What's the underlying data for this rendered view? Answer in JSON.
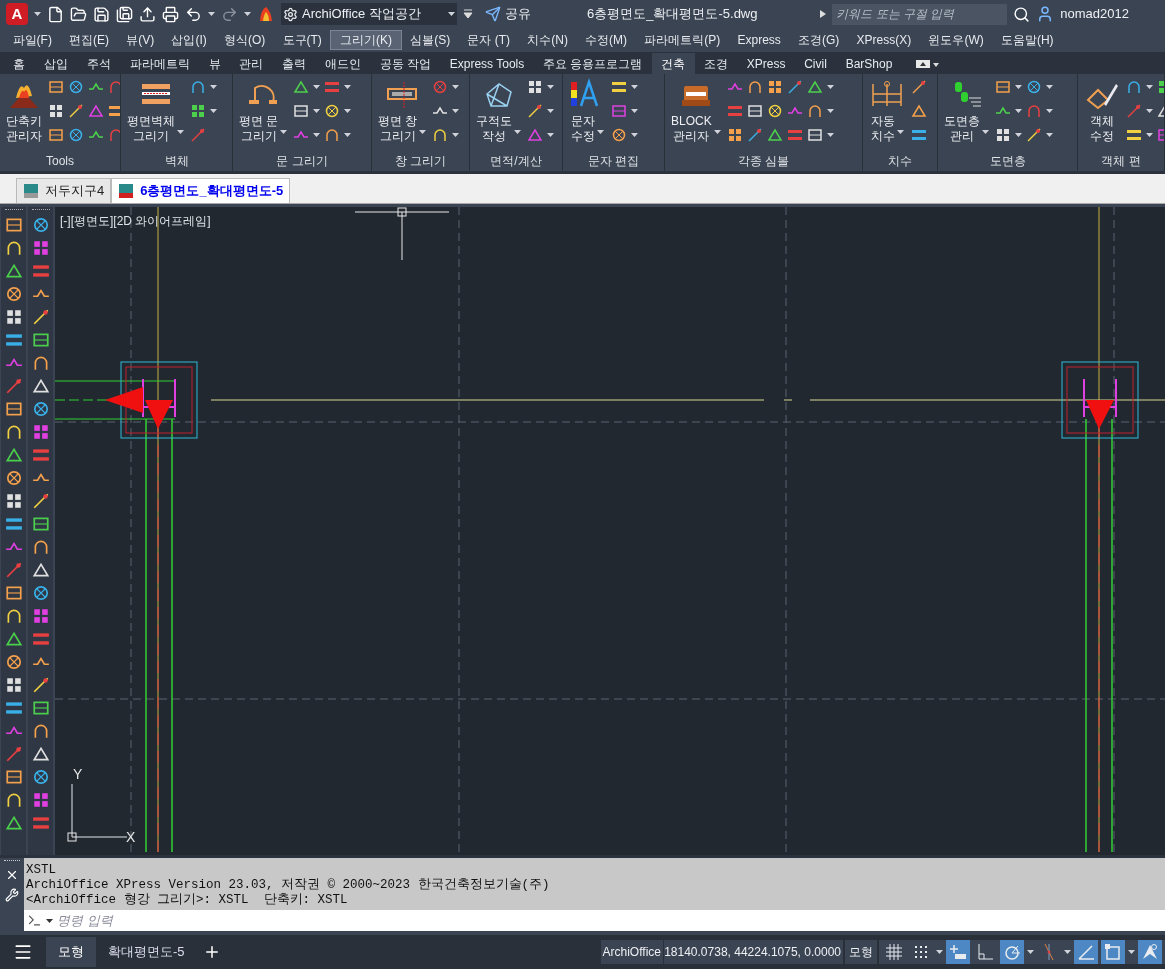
{
  "title_bar": {
    "logo_letter": "A",
    "workspace": "ArchiOffice 작업공간",
    "share": "공유",
    "file_title": "6층평면도_확대평면도-5.dwg",
    "search": {
      "placeholder": "키워드 또는 구절 입력"
    },
    "user": "nomad2012"
  },
  "menu_bar": [
    {
      "label": "파일(F)",
      "highlighted": false
    },
    {
      "label": "편집(E)",
      "highlighted": false
    },
    {
      "label": "뷰(V)",
      "highlighted": false
    },
    {
      "label": "삽입(I)",
      "highlighted": false
    },
    {
      "label": "형식(O)",
      "highlighted": false
    },
    {
      "label": "도구(T)",
      "highlighted": false
    },
    {
      "label": "그리기(K)",
      "highlighted": true
    },
    {
      "label": "심볼(S)",
      "highlighted": false
    },
    {
      "label": "문자 (T)",
      "highlighted": false
    },
    {
      "label": "치수(N)",
      "highlighted": false
    },
    {
      "label": "수정(M)",
      "highlighted": false
    },
    {
      "label": "파라메트릭(P)",
      "highlighted": false
    },
    {
      "label": "Express",
      "highlighted": false
    },
    {
      "label": "조경(G)",
      "highlighted": false
    },
    {
      "label": "XPress(X)",
      "highlighted": false
    },
    {
      "label": "윈도우(W)",
      "highlighted": false
    },
    {
      "label": "도움말(H)",
      "highlighted": false
    }
  ],
  "ribbon_tabs": [
    {
      "label": "홈",
      "selected": false
    },
    {
      "label": "삽입",
      "selected": false
    },
    {
      "label": "주석",
      "selected": false
    },
    {
      "label": "파라메트릭",
      "selected": false
    },
    {
      "label": "뷰",
      "selected": false
    },
    {
      "label": "관리",
      "selected": false
    },
    {
      "label": "출력",
      "selected": false
    },
    {
      "label": "애드인",
      "selected": false
    },
    {
      "label": "공동 작업",
      "selected": false
    },
    {
      "label": "Express Tools",
      "selected": false
    },
    {
      "label": "주요 응용프로그램",
      "selected": false
    },
    {
      "label": "건축",
      "selected": true
    },
    {
      "label": "조경",
      "selected": false
    },
    {
      "label": "XPress",
      "selected": false
    },
    {
      "label": "Civil",
      "selected": false
    },
    {
      "label": "BarShop",
      "selected": false
    }
  ],
  "ribbon_panels": [
    {
      "title": "Tools",
      "big_button": {
        "label": "단축키\n관리자",
        "dropdown": false
      }
    },
    {
      "title": "벽체",
      "big_button": {
        "label": "평면벽체\n그리기",
        "dropdown": true
      }
    },
    {
      "title": "문 그리기",
      "big_button": {
        "label": "평면 문\n그리기",
        "dropdown": true
      }
    },
    {
      "title": "창 그리기",
      "big_button": {
        "label": "평면 창\n그리기",
        "dropdown": true
      }
    },
    {
      "title": "면적/계산",
      "big_button": {
        "label": "구적도\n작성",
        "dropdown": true
      }
    },
    {
      "title": "문자 편집",
      "big_button": {
        "label": "문자\n수정",
        "dropdown": true
      }
    },
    {
      "title": "각종 심볼",
      "big_button": {
        "label": "BLOCK\n관리자",
        "dropdown": true
      }
    },
    {
      "title": "치수",
      "big_button": {
        "label": "자동\n치수",
        "dropdown": true
      }
    },
    {
      "title": "도면층",
      "big_button": {
        "label": "도면층\n관리",
        "dropdown": true
      }
    },
    {
      "title": "객체 편",
      "big_button": {
        "label": "객체\n수정",
        "dropdown": false
      }
    }
  ],
  "document_tabs": [
    {
      "label": "저두지구4",
      "selected": false
    },
    {
      "label": "6층평면도_확대평면도-5",
      "selected": true
    }
  ],
  "viewport": {
    "label": "[-][평면도][2D 와이어프레임]",
    "ucs_x": "X",
    "ucs_y": "Y"
  },
  "command_line": {
    "history": [
      "XSTL",
      "ArchiOffice XPress Version 23.03, 저작권 © 2000~2023 한국건축정보기술(주)",
      "<ArchiOffice 형강 그리기>: XSTL  단축키: XSTL"
    ],
    "placeholder": "명령 입력"
  },
  "layout_tabs": [
    {
      "label": "모형",
      "selected": true
    },
    {
      "label": "확대평면도-5",
      "selected": false
    }
  ],
  "status_bar": {
    "workspace": "ArchiOffice",
    "coordinates": "18140.0738, 44224.1075, 0.0000",
    "space": "모형",
    "toggles": [
      {
        "kind": "grid",
        "on": false,
        "dropdown": false
      },
      {
        "kind": "snap",
        "on": false,
        "dropdown": true
      },
      {
        "kind": "infer",
        "on": true,
        "dropdown": false
      },
      {
        "kind": "ortho",
        "on": false,
        "dropdown": false
      },
      {
        "kind": "polar",
        "on": true,
        "dropdown": true
      },
      {
        "kind": "isodraft",
        "on": false,
        "dropdown": true
      },
      {
        "kind": "ducs",
        "on": true,
        "dropdown": false
      },
      {
        "kind": "selection",
        "on": true,
        "dropdown": true
      },
      {
        "kind": "annotation",
        "on": true,
        "dropdown": false
      }
    ]
  }
}
